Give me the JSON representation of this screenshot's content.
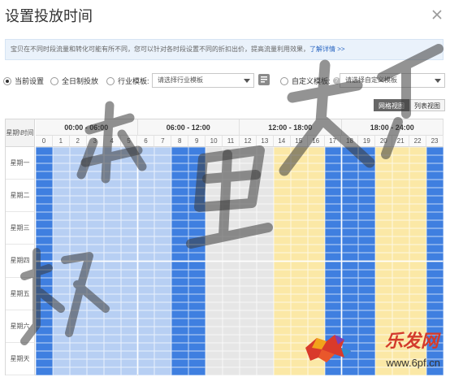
{
  "dialog": {
    "title": "设置投放时间",
    "close_icon": "close-icon"
  },
  "info": {
    "text": "宝贝在不同时段流量和转化可能有所不同，您可以针对各时段设置不同的折扣出价，提高流量利用效果，",
    "link": "了解详情 >>"
  },
  "options": {
    "current": {
      "label": "当前设置",
      "checked": true
    },
    "all_day": {
      "label": "全日制投放",
      "checked": false
    },
    "industry": {
      "label": "行业模板:",
      "checked": false,
      "select_value": "请选择行业模板"
    },
    "custom": {
      "label": "自定义模板:",
      "checked": false,
      "select_value": "请选择自定义模板"
    }
  },
  "view_toggle": {
    "grid_view": "网格视图",
    "list_view": "列表视图",
    "active": "grid_view"
  },
  "schedule": {
    "corner_label": "星期\\时间",
    "periods": [
      "00:00 - 06:00",
      "06:00 - 12:00",
      "12:00 - 18:00",
      "18:00 - 24:00"
    ],
    "hours": [
      "0",
      "1",
      "2",
      "3",
      "4",
      "5",
      "6",
      "7",
      "8",
      "9",
      "10",
      "11",
      "12",
      "13",
      "14",
      "15",
      "16",
      "17",
      "18",
      "19",
      "20",
      "21",
      "22",
      "23"
    ],
    "days": [
      "星期一",
      "星期二",
      "星期三",
      "星期四",
      "星期五",
      "星期六",
      "星期天"
    ],
    "hour_levels": [
      "dark",
      "light",
      "light",
      "light",
      "light",
      "light",
      "light",
      "light",
      "dark",
      "dark",
      "gray",
      "gray",
      "gray",
      "gray",
      "yellow",
      "yellow",
      "yellow",
      "dark",
      "dark",
      "dark",
      "yellow",
      "yellow",
      "yellow",
      "dark"
    ],
    "colors": {
      "dark": "#3f7fe0",
      "light": "#b7cff3",
      "gray": "#e6e6e6",
      "yellow": "#fbe8a6"
    }
  },
  "logo": {
    "brand": "乐发网",
    "url": "www.6pf.cn"
  }
}
